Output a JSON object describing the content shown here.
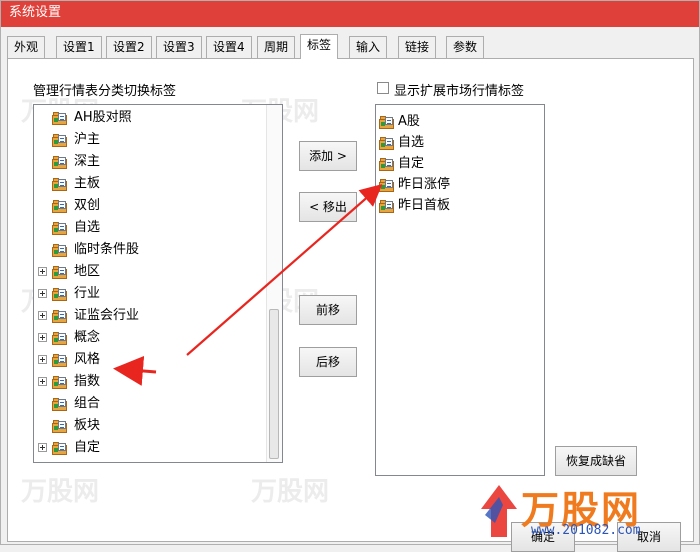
{
  "window": {
    "title": "系统设置",
    "accent": "#e0403a"
  },
  "tabs": [
    {
      "label": "外观"
    },
    {
      "label": "设置1"
    },
    {
      "label": "设置2"
    },
    {
      "label": "设置3"
    },
    {
      "label": "设置4"
    },
    {
      "label": "周期"
    },
    {
      "label": "标签",
      "active": true
    },
    {
      "label": "输入"
    },
    {
      "label": "链接"
    },
    {
      "label": "参数"
    }
  ],
  "left_panel": {
    "heading": "管理行情表分类切换标签",
    "items": [
      {
        "label": "AH股对照",
        "expandable": false
      },
      {
        "label": "沪主",
        "expandable": false
      },
      {
        "label": "深主",
        "expandable": false
      },
      {
        "label": "主板",
        "expandable": false
      },
      {
        "label": "双创",
        "expandable": false
      },
      {
        "label": "自选",
        "expandable": false
      },
      {
        "label": "临时条件股",
        "expandable": false
      },
      {
        "label": "地区",
        "expandable": true
      },
      {
        "label": "行业",
        "expandable": true
      },
      {
        "label": "证监会行业",
        "expandable": true
      },
      {
        "label": "概念",
        "expandable": true
      },
      {
        "label": "风格",
        "expandable": true
      },
      {
        "label": "指数",
        "expandable": true
      },
      {
        "label": "组合",
        "expandable": false
      },
      {
        "label": "板块",
        "expandable": false
      },
      {
        "label": "自定",
        "expandable": true
      }
    ]
  },
  "middle_buttons": {
    "add": "添加 >",
    "remove": "< 移出",
    "move_up": "前移",
    "move_down": "后移"
  },
  "right_panel": {
    "checkbox_label": "显示扩展市场行情标签",
    "items": [
      {
        "label": "A股"
      },
      {
        "label": "自选"
      },
      {
        "label": "自定"
      },
      {
        "label": "昨日涨停"
      },
      {
        "label": "昨日首板"
      }
    ]
  },
  "restore_button": "恢复成缺省",
  "footer": {
    "ok": "确定",
    "cancel": "取消"
  },
  "watermark": {
    "text": "万股网",
    "url": "www.201082.com",
    "brand_color": "#f07a1e",
    "url_color": "#2c55b8"
  },
  "annotation_color": "#e8261f"
}
